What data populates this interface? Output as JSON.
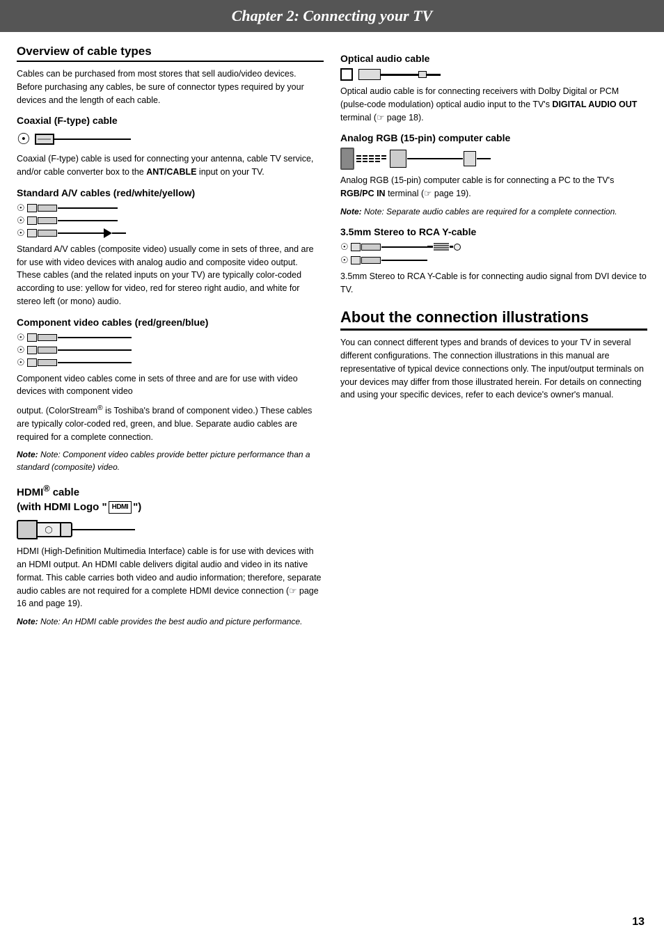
{
  "header": {
    "title": "Chapter 2: Connecting your TV"
  },
  "left_col": {
    "overview_title": "Overview of cable types",
    "overview_text": "Cables can be purchased from most stores that sell audio/video devices. Before purchasing any cables, be sure of connector types required by your devices and the length of each cable.",
    "coaxial": {
      "title": "Coaxial (F-type) cable",
      "text": "Coaxial (F-type) cable is used for connecting your antenna, cable TV service, and/or cable converter box to the ",
      "bold": "ANT/CABLE",
      "text2": " input on your TV."
    },
    "av_cables": {
      "title": "Standard A/V cables (red/white/yellow)",
      "text": "Standard A/V cables (composite video) usually come in sets of three, and are for use with video devices with analog audio and composite video output. These cables (and the related inputs on your TV) are typically color-coded according to use: yellow for video, red for stereo right audio, and white for stereo left (or mono) audio."
    },
    "component": {
      "title": "Component video cables (red/green/blue)",
      "text1": "Component video cables come in sets of three and are for use with video devices with component video",
      "text2": "output. (ColorStream",
      "sup": "®",
      "text3": " is Toshiba's brand of component video.) These cables are typically color-coded red, green, and blue. Separate audio cables are required for a complete connection.",
      "note": "Note: Component video cables provide better picture performance than a standard (composite) video."
    },
    "hdmi": {
      "title1": "HDMI",
      "sup": "®",
      "title2": " cable",
      "title3": "(with HDMI Logo \"",
      "logo": "HDMI",
      "title4": "\")",
      "text": "HDMI (High-Definition Multimedia Interface) cable is for use with devices with an HDMI output. An HDMI cable delivers digital audio and video in its native format. This cable carries both video and audio information; therefore, separate audio cables are not required for a complete HDMI device connection (",
      "ref": "☞",
      "text2": " page 16 and page 19).",
      "note": "Note: An HDMI cable provides the best audio and picture performance."
    }
  },
  "right_col": {
    "optical": {
      "title": "Optical audio cable",
      "text": "Optical audio cable is for connecting receivers with Dolby Digital or PCM (pulse-code modulation) optical audio input to the TV's ",
      "bold": "DIGITAL AUDIO OUT",
      "text2": " terminal (",
      "ref": "☞",
      "text3": " page 18)."
    },
    "analog_rgb": {
      "title": "Analog RGB (15-pin) computer cable",
      "text": "Analog RGB (15-pin) computer cable is for connecting a PC to the TV's ",
      "bold": "RGB/PC IN",
      "text2": " terminal (",
      "ref": "☞",
      "text3": " page 19).",
      "note": "Note: Separate audio cables are required for a complete connection."
    },
    "stereo_rca": {
      "title": "3.5mm Stereo to RCA Y-cable",
      "text": "3.5mm Stereo to RCA Y-Cable is for connecting audio signal from DVI device to TV."
    },
    "about": {
      "title": "About the connection illustrations",
      "text": "You can connect different types and brands of devices to your TV in several different configurations. The connection illustrations in this manual are representative of typical device connections only. The input/output terminals on your devices may differ from those illustrated herein. For details on connecting and using your specific devices, refer to each device's owner's manual."
    }
  },
  "page_number": "13"
}
